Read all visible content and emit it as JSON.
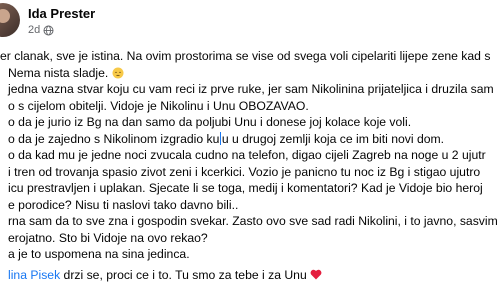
{
  "post": {
    "author": "Ida Prester",
    "meta": "2d",
    "lines": [
      "er clanak, sve je istina. Na ovim prostorima se vise od svega voli cipelariti lijepe zene kad s",
      "Nema nista sladje.",
      "jedna vazna stvar koju cu vam reci iz prve ruke, jer sam Nikolinina prijateljica i druzila sam",
      "o s cijelom obitelji. Vidoje je Nikolinu i Unu OBOZAVAO.",
      "o da je jurio iz Bg na dan samo da poljubi Unu i donese joj kolace koje voli.",
      "o da je zajedno s Nikolinom izgradio ku",
      "u u drugoj zemlji koja ce im biti novi dom.",
      "o da kad mu je jedne noci zvucala cudno na telefon, digao cijeli Zagreb na noge u 2 ujutr",
      "i tren od trovanja spasio zivot zeni i kcerkici. Vozio je panicno tu noc iz Bg i stigao ujutro",
      "icu prestravljen i uplakan. Sjecate li se toga, medij i komentatori? Kad je Vidoje bio heroj",
      "e porodice? Nisu ti naslovi tako davno bili..",
      "rna sam da to sve zna i gospodin svekar. Zasto ovo sve sad radi Nikolini, i to javno, sasvim",
      "erojatno. Sto bi Vidoje na ovo rekao?",
      "a je to uspomena na sina jedinca.",
      "lina Pisek",
      " drzi se, proci ce i to. Tu smo za tebe i za Unu"
    ]
  },
  "icons": {
    "emoji": "pensive-face-emoji-icon",
    "heart": "red-heart-icon",
    "globe": "globe-icon"
  },
  "colors": {
    "text": "#050505",
    "secondary": "#65676b",
    "link": "#1877f2",
    "heart": "#e41e3f"
  }
}
